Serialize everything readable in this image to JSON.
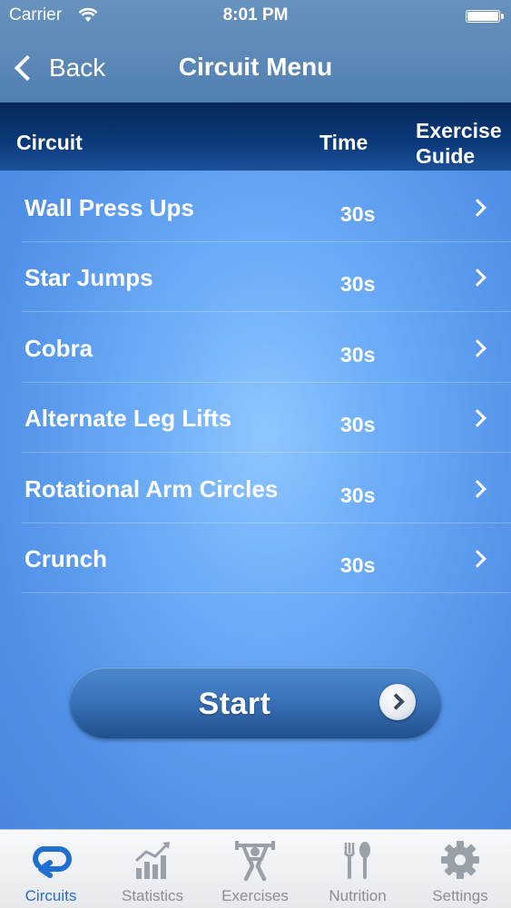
{
  "status_bar": {
    "carrier": "Carrier",
    "time": "8:01 PM"
  },
  "nav": {
    "back_label": "Back",
    "title": "Circuit Menu"
  },
  "columns": {
    "circuit": "Circuit",
    "time": "Time",
    "guide_line1": "Exercise",
    "guide_line2": "Guide"
  },
  "exercises": [
    {
      "name": "Wall Press Ups",
      "time": "30s"
    },
    {
      "name": "Star Jumps",
      "time": "30s"
    },
    {
      "name": "Cobra",
      "time": "30s"
    },
    {
      "name": "Alternate Leg Lifts",
      "time": "30s"
    },
    {
      "name": "Rotational Arm Circles",
      "time": "30s"
    },
    {
      "name": "Crunch",
      "time": "30s"
    }
  ],
  "start_label": "Start",
  "tabs": [
    {
      "label": "Circuits",
      "icon": "circuits-icon",
      "active": true
    },
    {
      "label": "Statistics",
      "icon": "statistics-icon",
      "active": false
    },
    {
      "label": "Exercises",
      "icon": "exercises-icon",
      "active": false
    },
    {
      "label": "Nutrition",
      "icon": "nutrition-icon",
      "active": false
    },
    {
      "label": "Settings",
      "icon": "settings-icon",
      "active": false
    }
  ],
  "colors": {
    "accent": "#1e6fd2",
    "inactive_tab": "#8a8f96",
    "header": "#0b3a7a"
  }
}
